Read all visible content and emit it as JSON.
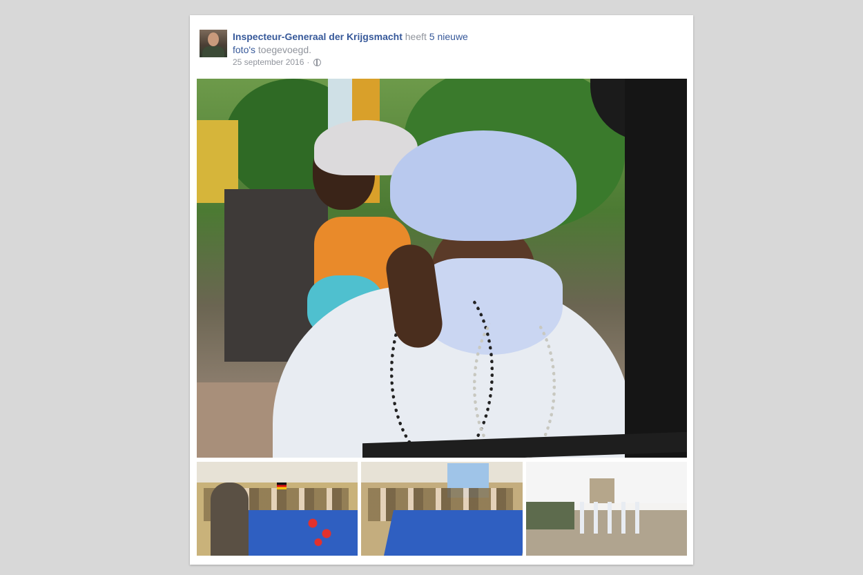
{
  "post": {
    "author": "Inspecteur-Generaal der Krijgsmacht",
    "verb": "heeft",
    "count_link": "5 nieuwe",
    "photos_link": "foto's",
    "suffix": "toegevoegd.",
    "date": "25 september 2016",
    "separator": "·",
    "privacy_icon": "globe-icon"
  },
  "photos": {
    "main": "photo-man-in-turban",
    "thumbnails": [
      "photo-meeting-table-1",
      "photo-meeting-table-2",
      "photo-camp-visit"
    ]
  }
}
